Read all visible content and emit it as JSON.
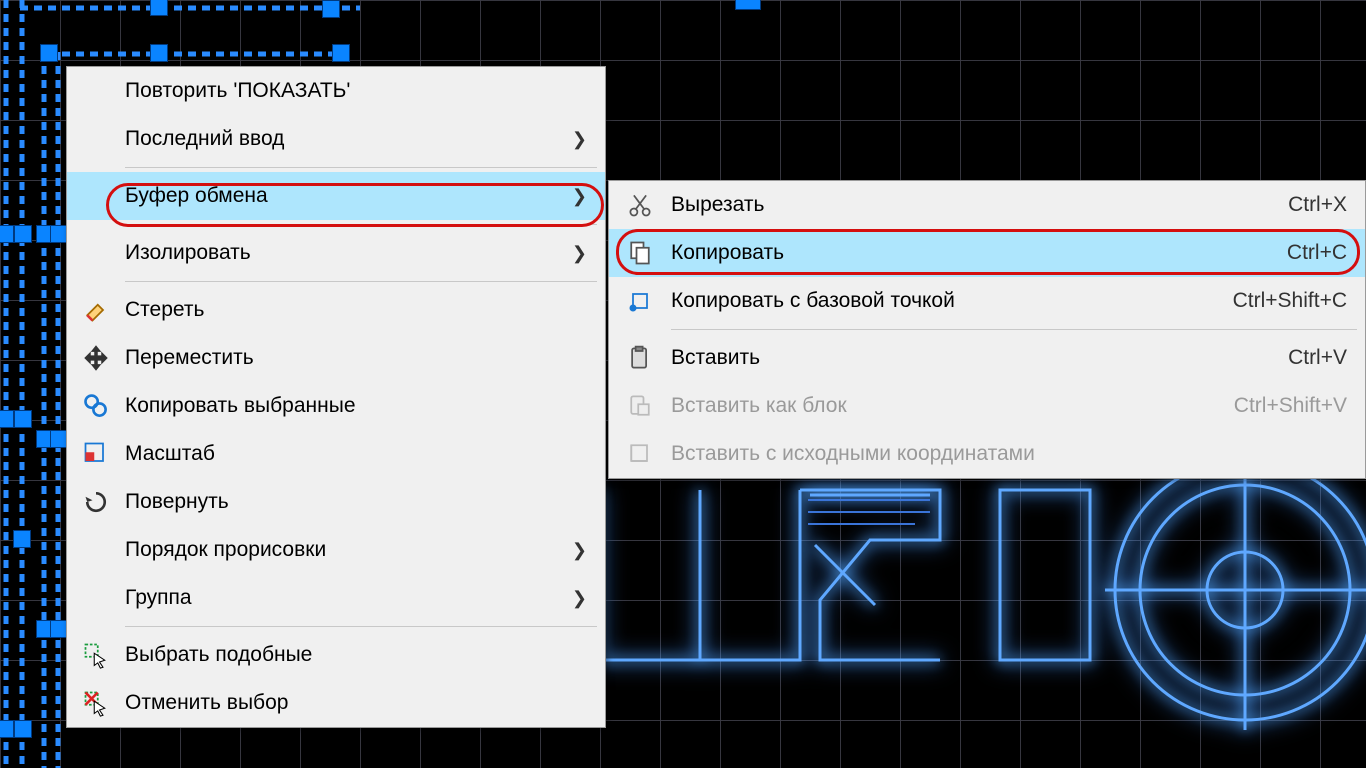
{
  "main_menu": {
    "repeat": "Повторить 'ПОКАЗАТЬ'",
    "recent_input": "Последний ввод",
    "clipboard": "Буфер обмена",
    "isolate": "Изолировать",
    "erase": "Стереть",
    "move": "Переместить",
    "copy_selection": "Копировать выбранные",
    "scale": "Масштаб",
    "rotate": "Повернуть",
    "draw_order": "Порядок прорисовки",
    "group": "Группа",
    "select_similar": "Выбрать подобные",
    "deselect": "Отменить выбор"
  },
  "submenu": {
    "cut": {
      "label": "Вырезать",
      "shortcut": "Ctrl+X"
    },
    "copy": {
      "label": "Копировать",
      "shortcut": "Ctrl+C"
    },
    "copy_base": {
      "label": "Копировать с базовой точкой",
      "shortcut": "Ctrl+Shift+C"
    },
    "paste": {
      "label": "Вставить",
      "shortcut": "Ctrl+V"
    },
    "paste_block": {
      "label": "Вставить как блок",
      "shortcut": "Ctrl+Shift+V"
    },
    "paste_orig": {
      "label": "Вставить с исходными координатами",
      "shortcut": ""
    }
  }
}
